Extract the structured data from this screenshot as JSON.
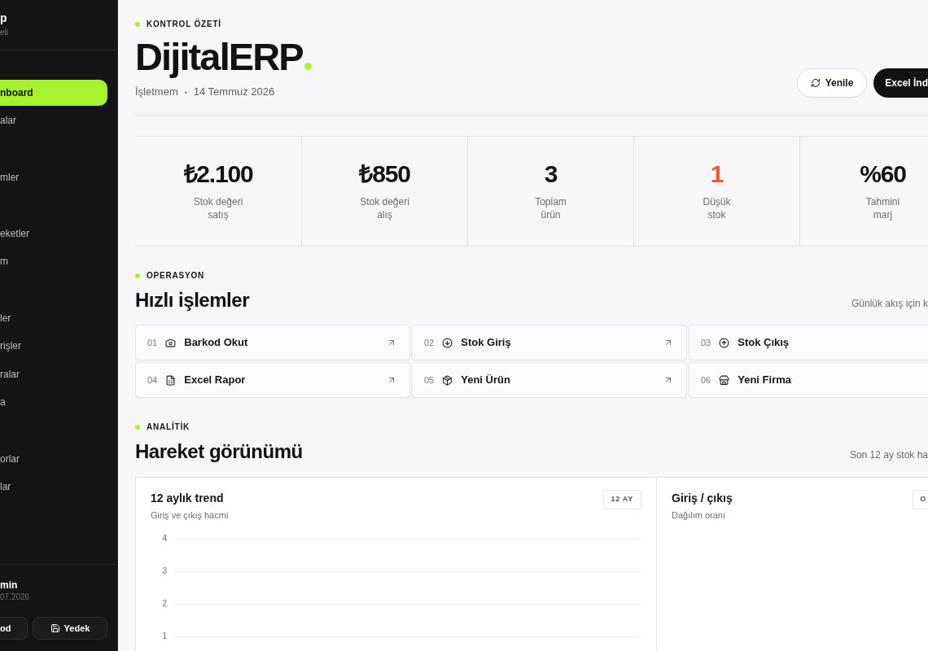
{
  "sidebar": {
    "brand": {
      "name": "p",
      "subtitle": "eli"
    },
    "sections": [
      {
        "items": [
          {
            "label": "nboard",
            "selected": true
          },
          {
            "label": "alar",
            "selected": false
          }
        ]
      },
      {
        "items": [
          {
            "label": "mler",
            "selected": false
          }
        ]
      },
      {
        "items": [
          {
            "label": "eketler",
            "selected": false
          },
          {
            "label": "m",
            "selected": false
          }
        ]
      },
      {
        "items": [
          {
            "label": "ler",
            "selected": false
          },
          {
            "label": "rişler",
            "selected": false
          },
          {
            "label": "ralar",
            "selected": false
          },
          {
            "label": "a",
            "selected": false
          }
        ]
      },
      {
        "items": [
          {
            "label": "orlar",
            "selected": false
          },
          {
            "label": "lar",
            "selected": false
          }
        ]
      }
    ],
    "user": {
      "name": "min",
      "date": "07.2026"
    },
    "buttons": [
      {
        "label": "od",
        "kind": "plain"
      },
      {
        "label": "Yedek",
        "kind": "save"
      }
    ]
  },
  "header": {
    "eyebrow": "KONTROL ÖZETİ",
    "title": "DijitalERP",
    "subtitle": [
      "İşletmem",
      "14 Temmuz 2026"
    ],
    "actions": [
      {
        "label": "Yenile",
        "kind": "outline"
      },
      {
        "label": "Excel İnd",
        "kind": "solid"
      }
    ]
  },
  "stats": [
    {
      "value": "₺2.100",
      "label": "Stok değeri\nsatış",
      "alert": false
    },
    {
      "value": "₺850",
      "label": "Stok değeri\nalış",
      "alert": false
    },
    {
      "value": "3",
      "label": "Toplam\nürün",
      "alert": false
    },
    {
      "value": "1",
      "label": "Düşük\nstok",
      "alert": true
    },
    {
      "value": "%60",
      "label": "Tahmini\nmarj",
      "alert": false
    }
  ],
  "quick_actions": {
    "eyebrow": "OPERASYON",
    "title": "Hızlı işlemler",
    "note": "Günlük akış için k",
    "items": [
      {
        "number": "01",
        "label": "Barkod Okut",
        "arrow": true
      },
      {
        "number": "02",
        "label": "Stok Giriş",
        "arrow": true
      },
      {
        "number": "03",
        "label": "Stok Çıkış",
        "arrow": false
      },
      {
        "number": "04",
        "label": "Excel Rapor",
        "arrow": true
      },
      {
        "number": "05",
        "label": "Yeni Ürün",
        "arrow": true
      },
      {
        "number": "06",
        "label": "Yeni Firma",
        "arrow": false
      }
    ]
  },
  "analytics": {
    "eyebrow": "ANALİTİK",
    "title": "Hareket görünümü",
    "note": "Son 12 ay stok ha",
    "cards": [
      {
        "title": "12 aylık trend",
        "subtitle": "Giriş ve çıkış hacmi",
        "badge": "12 AY",
        "axis_labels": [
          "4",
          "3",
          "2",
          "1"
        ]
      },
      {
        "title": "Giriş / çıkış",
        "subtitle": "Dağılım oranı",
        "badge": "O"
      }
    ]
  }
}
